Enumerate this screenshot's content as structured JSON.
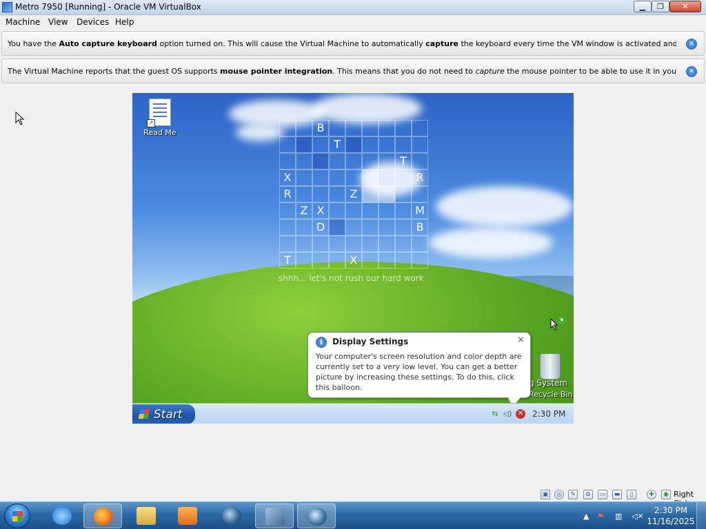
{
  "window": {
    "title": "Metro 7950 [Running] - Oracle VM VirtualBox",
    "buttons": {
      "minimize": "▁",
      "maximize": "❐",
      "close": "✕"
    }
  },
  "menu": [
    "Machine",
    "View",
    "Devices",
    "Help"
  ],
  "notices": [
    {
      "segments": [
        {
          "t": "You have the "
        },
        {
          "t": "Auto capture keyboard",
          "b": true
        },
        {
          "t": " option turned on. This will cause the Virtual Machine to automatically "
        },
        {
          "t": "capture",
          "b": true
        },
        {
          "t": " the keyboard every time the VM window is activated and make it unavailable to"
        }
      ]
    },
    {
      "segments": [
        {
          "t": "The Virtual Machine reports that the guest OS supports "
        },
        {
          "t": "mouse pointer integration",
          "b": true
        },
        {
          "t": ". This means that you do not need to "
        },
        {
          "t": "capture",
          "i": true
        },
        {
          "t": " the mouse pointer to be able to use it in your guest OS -- all mouse"
        }
      ]
    }
  ],
  "guest": {
    "desktop_icons": [
      {
        "label": "Read Me",
        "icon": "shortcut-document-icon"
      }
    ],
    "grid": {
      "letters": [
        {
          "r": 0,
          "c": 2,
          "ch": "B"
        },
        {
          "r": 1,
          "c": 3,
          "ch": "T"
        },
        {
          "r": 2,
          "c": 7,
          "ch": "T"
        },
        {
          "r": 3,
          "c": 0,
          "ch": "X"
        },
        {
          "r": 3,
          "c": 8,
          "ch": "R"
        },
        {
          "r": 4,
          "c": 0,
          "ch": "R"
        },
        {
          "r": 4,
          "c": 4,
          "ch": "Z"
        },
        {
          "r": 5,
          "c": 1,
          "ch": "Z"
        },
        {
          "r": 5,
          "c": 2,
          "ch": "X"
        },
        {
          "r": 5,
          "c": 8,
          "ch": "M"
        },
        {
          "r": 6,
          "c": 2,
          "ch": "D"
        },
        {
          "r": 6,
          "c": 8,
          "ch": "B"
        },
        {
          "r": 8,
          "c": 0,
          "ch": "T"
        },
        {
          "r": 8,
          "c": 4,
          "ch": "X"
        }
      ],
      "dark_cells": [
        [
          1,
          1
        ],
        [
          1,
          4
        ],
        [
          2,
          2
        ],
        [
          6,
          3
        ]
      ],
      "light_cells": [
        [
          4,
          6
        ],
        [
          4,
          5
        ],
        [
          3,
          5
        ]
      ],
      "caption": "shhh... let's not rush our hard work"
    },
    "recycle_bin": {
      "label_line1": "g System",
      "label_line2": "Recycle Bin"
    },
    "balloon": {
      "title": "Display Settings",
      "close": "×",
      "info_glyph": "i",
      "body": "Your computer's screen resolution and color depth are currently set to a very low level. You can get a better picture by increasing these settings. To do this, click this balloon."
    },
    "taskbar": {
      "start": "Start",
      "clock": "2:30 PM",
      "tray_icons": [
        "network-icon",
        "volume-icon",
        "security-alert-icon"
      ]
    }
  },
  "statusbar": {
    "icons": [
      "hard-disk-icon",
      "optical-drive-icon",
      "pencil-icon",
      "network-icon",
      "shared-folder-icon",
      "display-icon",
      "video-capture-icon",
      "mouse-integration-icon",
      "virtualization-icon"
    ],
    "host_key": "Right Ctrl"
  },
  "host_taskbar": {
    "apps": [
      "internet-explorer-icon",
      "firefox-icon",
      "file-explorer-icon",
      "media-player-icon",
      "virtualbox-guest-icon",
      "virtualbox-icon",
      "virtualbox-vm-icon"
    ],
    "active_indices": [
      1,
      5,
      6
    ],
    "tray": {
      "chevron": "▲"
    },
    "clock_time": "2:30 PM",
    "clock_date": "11/16/2025"
  }
}
